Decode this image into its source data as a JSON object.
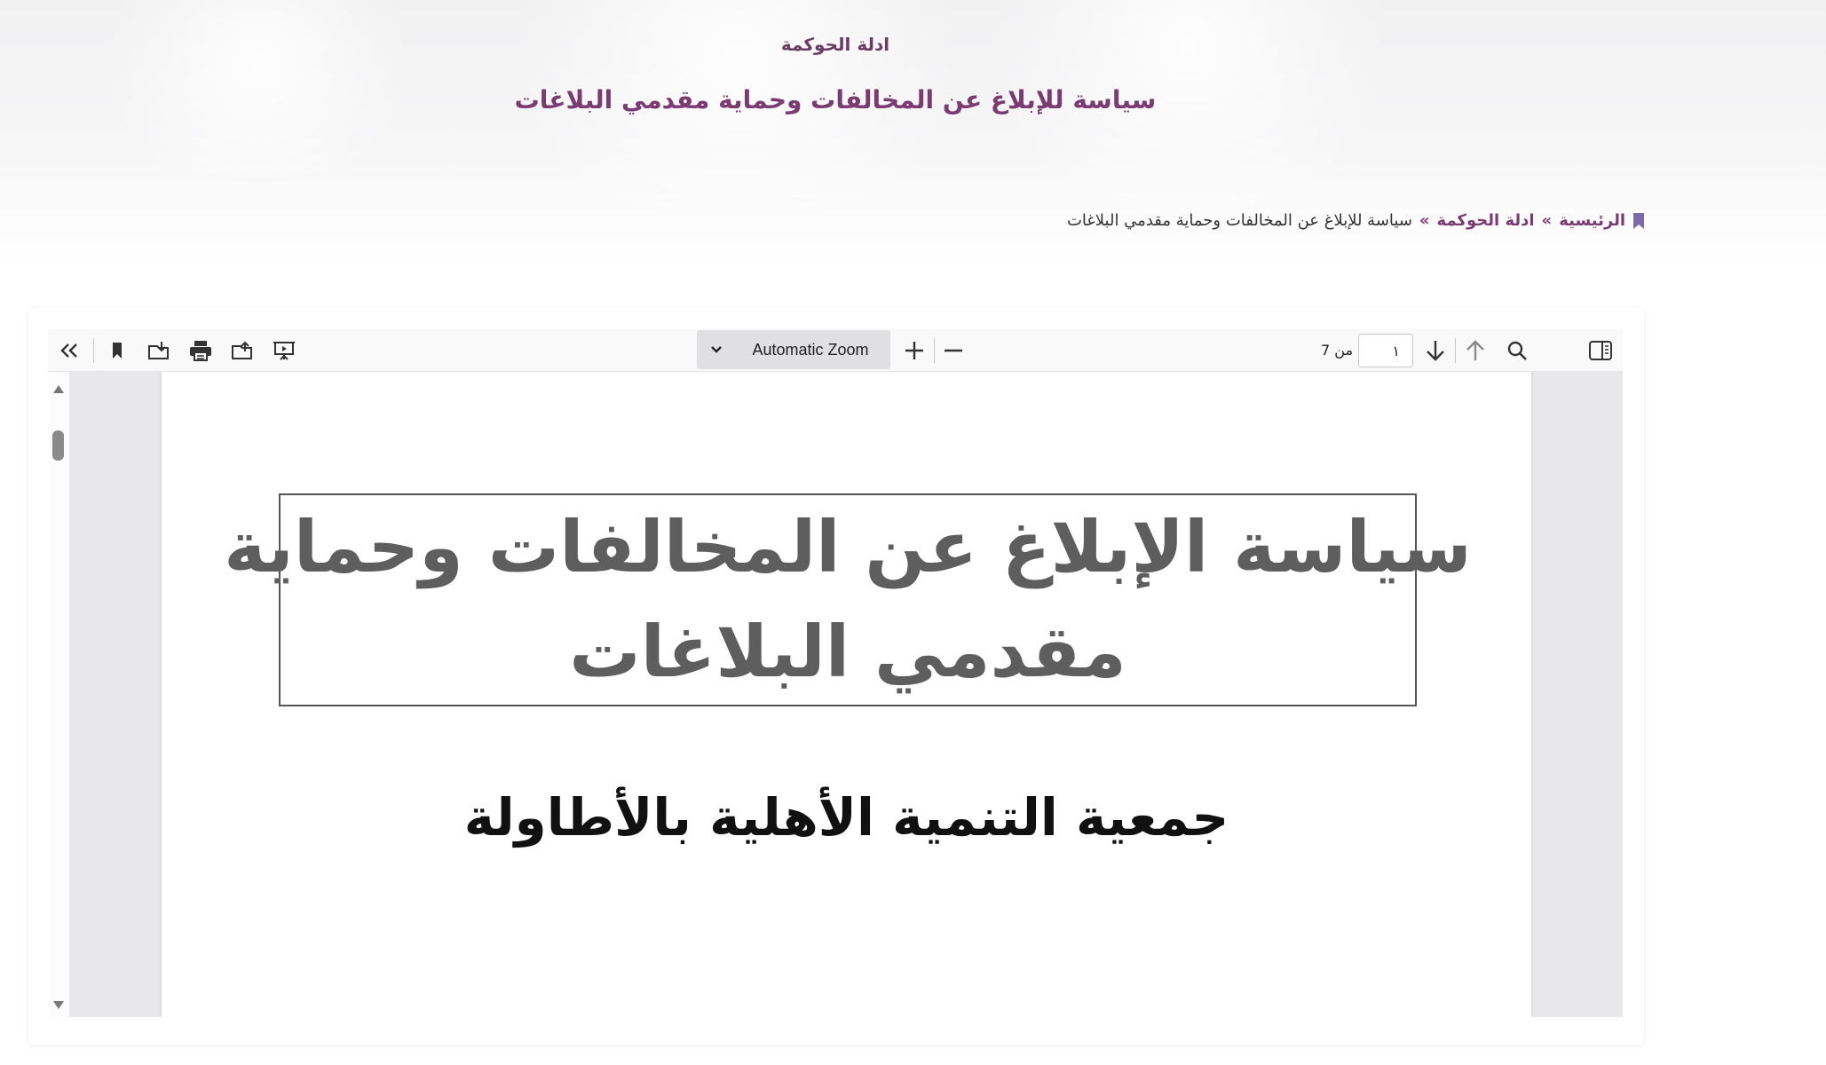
{
  "header": {
    "category": "ادلة الحوكمة",
    "title": "سياسة للإبلاغ عن المخالفات وحماية مقدمي البلاغات"
  },
  "breadcrumb": {
    "home": "الرئيسية",
    "separator": "»",
    "category": "ادلة الحوكمة",
    "current": "سياسة للإبلاغ عن المخالفات وحماية مقدمي البلاغات"
  },
  "viewer": {
    "zoom_label": "Automatic Zoom",
    "page_number": "١",
    "page_count_label": "من 7",
    "icons": {
      "sidebar": "sidebar-toggle-icon",
      "find": "search-icon",
      "previous": "arrow-up-icon",
      "next": "arrow-down-icon",
      "zoom_out": "minus-icon",
      "zoom_in": "plus-icon",
      "presentation": "presentation-icon",
      "open": "open-file-icon",
      "print": "print-icon",
      "download": "download-icon",
      "bookmark": "bookmark-icon",
      "tools": "double-chevron-icon"
    }
  },
  "document": {
    "title_line_1": "سياسة الإبلاغ عن المخالفات وحماية",
    "title_line_2": "مقدمي البلاغات",
    "organization": "جمعية التنمية الأهلية بالأطاولة"
  },
  "colors": {
    "accent": "#7a3a72",
    "toolbar_bg": "#f9f9fa",
    "viewer_bg": "#e8e8ea"
  }
}
